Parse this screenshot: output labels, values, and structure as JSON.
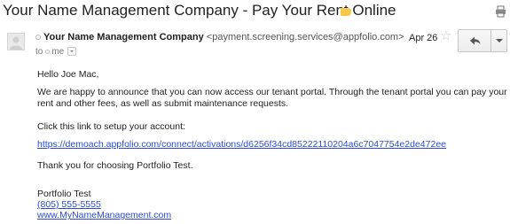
{
  "subject": "Your Name Management Company - Pay Your Rent Online",
  "icons": {
    "label": "label-tag-icon",
    "print": "print-icon",
    "avatar": "avatar-icon",
    "star": "star-icon",
    "reply": "reply-icon",
    "more": "chevron-down-icon"
  },
  "colors": {
    "label_tag": "#f6c94a",
    "link": "#2a4bd7"
  },
  "message": {
    "sender_name": "Your Name Management Company",
    "sender_email": "<payment.screening.services@appfolio.com>",
    "to_label": "to",
    "to_value": "me",
    "date": "Apr 26"
  },
  "body": {
    "greeting": "Hello Joe Mac,",
    "announce": "We are happy to announce that you can now access our tenant portal. Through the tenant portal you can pay your rent and other fees, as well as submit maintenance requests.",
    "click_text": "Click this link to setup your account:",
    "setup_link": "https://demoach.appfolio.com/connect/activations/d6256f34cd85222110204a6c7047754e2de472ee",
    "thanks": "Thank you for choosing Portfolio Test.",
    "signature_name": "Portfolio Test",
    "signature_phone": "(805) 555-5555",
    "signature_site": "www.MyNameManagement.com"
  }
}
